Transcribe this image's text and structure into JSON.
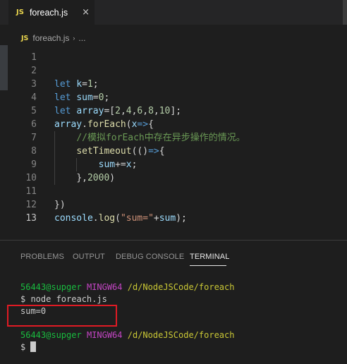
{
  "tab": {
    "badge": "JS",
    "label": "foreach.js",
    "close_glyph": "×"
  },
  "breadcrumb": {
    "badge": "JS",
    "file": "foreach.js",
    "separator": "›",
    "more": "..."
  },
  "editor": {
    "active_line": 13,
    "lines": [
      {
        "num": "1",
        "tokens": []
      },
      {
        "num": "2",
        "tokens": []
      },
      {
        "num": "3",
        "tokens": [
          {
            "t": "let",
            "c": "kw"
          },
          {
            "t": " ",
            "c": "plain"
          },
          {
            "t": "k",
            "c": "var"
          },
          {
            "t": "=",
            "c": "plain"
          },
          {
            "t": "1",
            "c": "num"
          },
          {
            "t": ";",
            "c": "plain"
          }
        ]
      },
      {
        "num": "4",
        "tokens": [
          {
            "t": "let",
            "c": "kw"
          },
          {
            "t": " ",
            "c": "plain"
          },
          {
            "t": "sum",
            "c": "var"
          },
          {
            "t": "=",
            "c": "plain"
          },
          {
            "t": "0",
            "c": "num"
          },
          {
            "t": ";",
            "c": "plain"
          }
        ]
      },
      {
        "num": "5",
        "tokens": [
          {
            "t": "let",
            "c": "kw"
          },
          {
            "t": " ",
            "c": "plain"
          },
          {
            "t": "array",
            "c": "var"
          },
          {
            "t": "=[",
            "c": "plain"
          },
          {
            "t": "2",
            "c": "num"
          },
          {
            "t": ",",
            "c": "plain"
          },
          {
            "t": "4",
            "c": "num"
          },
          {
            "t": ",",
            "c": "plain"
          },
          {
            "t": "6",
            "c": "num"
          },
          {
            "t": ",",
            "c": "plain"
          },
          {
            "t": "8",
            "c": "num"
          },
          {
            "t": ",",
            "c": "plain"
          },
          {
            "t": "10",
            "c": "num"
          },
          {
            "t": "];",
            "c": "plain"
          }
        ]
      },
      {
        "num": "6",
        "tokens": [
          {
            "t": "array",
            "c": "var"
          },
          {
            "t": ".",
            "c": "plain"
          },
          {
            "t": "forEach",
            "c": "fn"
          },
          {
            "t": "(",
            "c": "plain"
          },
          {
            "t": "x",
            "c": "var"
          },
          {
            "t": "=>",
            "c": "kw"
          },
          {
            "t": "{",
            "c": "plain"
          }
        ]
      },
      {
        "num": "7",
        "indent": 1,
        "tokens": [
          {
            "t": "    ",
            "c": "plain"
          },
          {
            "t": "//模拟forEach中存在异步操作的情况。",
            "c": "cmt"
          }
        ]
      },
      {
        "num": "8",
        "indent": 1,
        "tokens": [
          {
            "t": "    ",
            "c": "plain"
          },
          {
            "t": "setTimeout",
            "c": "fn"
          },
          {
            "t": "(()",
            "c": "plain"
          },
          {
            "t": "=>",
            "c": "kw"
          },
          {
            "t": "{",
            "c": "plain"
          }
        ]
      },
      {
        "num": "9",
        "indent": 2,
        "tokens": [
          {
            "t": "        ",
            "c": "plain"
          },
          {
            "t": "sum",
            "c": "var"
          },
          {
            "t": "+=",
            "c": "plain"
          },
          {
            "t": "x",
            "c": "var"
          },
          {
            "t": ";",
            "c": "plain"
          }
        ]
      },
      {
        "num": "10",
        "indent": 1,
        "tokens": [
          {
            "t": "    ",
            "c": "plain"
          },
          {
            "t": "},",
            "c": "plain"
          },
          {
            "t": "2000",
            "c": "num"
          },
          {
            "t": ")",
            "c": "plain"
          }
        ]
      },
      {
        "num": "11",
        "tokens": []
      },
      {
        "num": "12",
        "tokens": [
          {
            "t": "})",
            "c": "plain"
          }
        ]
      },
      {
        "num": "13",
        "tokens": [
          {
            "t": "console",
            "c": "var"
          },
          {
            "t": ".",
            "c": "plain"
          },
          {
            "t": "log",
            "c": "fn"
          },
          {
            "t": "(",
            "c": "plain"
          },
          {
            "t": "\"sum=\"",
            "c": "str"
          },
          {
            "t": "+",
            "c": "plain"
          },
          {
            "t": "sum",
            "c": "var"
          },
          {
            "t": ");",
            "c": "plain"
          }
        ]
      }
    ]
  },
  "panel": {
    "tabs": [
      "PROBLEMS",
      "OUTPUT",
      "DEBUG CONSOLE",
      "TERMINAL"
    ],
    "active_tab": "TERMINAL"
  },
  "terminal": {
    "prompt1": {
      "user": "56443@supger",
      "shell": "MINGW64",
      "path": "/d/NodeJSCode/foreach"
    },
    "command": "$ node foreach.js",
    "output": "sum=0",
    "prompt2": {
      "user": "56443@supger",
      "shell": "MINGW64",
      "path": "/d/NodeJSCode/foreach"
    },
    "input_prefix": "$"
  },
  "colors": {
    "background": "#1e1e1e",
    "keyword": "#569cd6",
    "variable": "#9cdcfe",
    "number": "#b5cea8",
    "function": "#dcdcaa",
    "string": "#ce9178",
    "comment": "#6a9955",
    "terminal_user": "#19bc3f",
    "terminal_shell": "#c345c3",
    "terminal_path": "#c9c735",
    "highlight_box": "#e01b24"
  }
}
